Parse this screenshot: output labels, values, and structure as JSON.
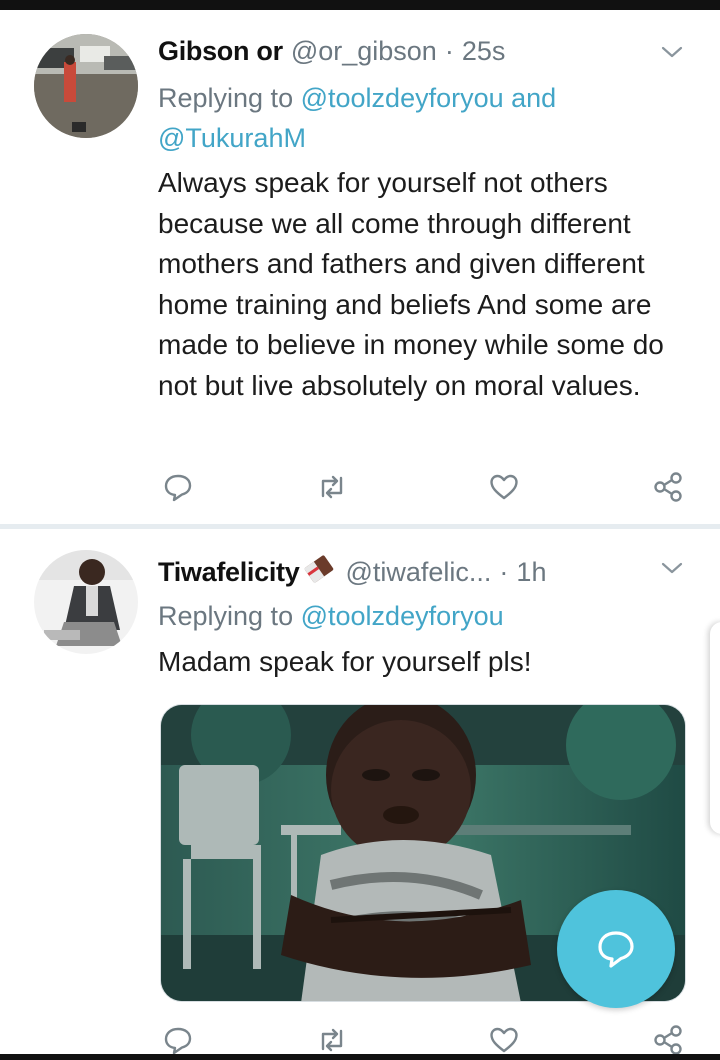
{
  "colors": {
    "accent": "#42a5c7",
    "secondary_text": "#6b7780",
    "fab": "#4fc3dc",
    "separator": "#e6ecf0"
  },
  "tweets": [
    {
      "display_name": "Gibson or",
      "handle": "@or_gibson",
      "separator": "·",
      "time": "25s",
      "reply_prefix": "Replying to",
      "reply_mention_1": "@toolzdeyforyou",
      "reply_joiner": "and",
      "reply_mention_2": "@TukurahM",
      "text": "Always speak for yourself not others because we all come through different mothers and fathers and given different home training and beliefs And some are made to believe in money while some do not but live absolutely on moral values.",
      "icons": [
        "reply-icon",
        "retweet-icon",
        "like-icon",
        "share-icon"
      ]
    },
    {
      "display_name": "Tiwafelicity",
      "handle": "@tiwafelic...",
      "separator": "·",
      "time": "1h",
      "reply_prefix": "Replying to",
      "reply_mention_1": "@toolzdeyforyou",
      "text": "Madam speak for yourself pls!",
      "icons": [
        "reply-icon",
        "retweet-icon",
        "like-icon",
        "share-icon"
      ]
    }
  ],
  "fab": {
    "icon": "compose-reply-icon"
  }
}
